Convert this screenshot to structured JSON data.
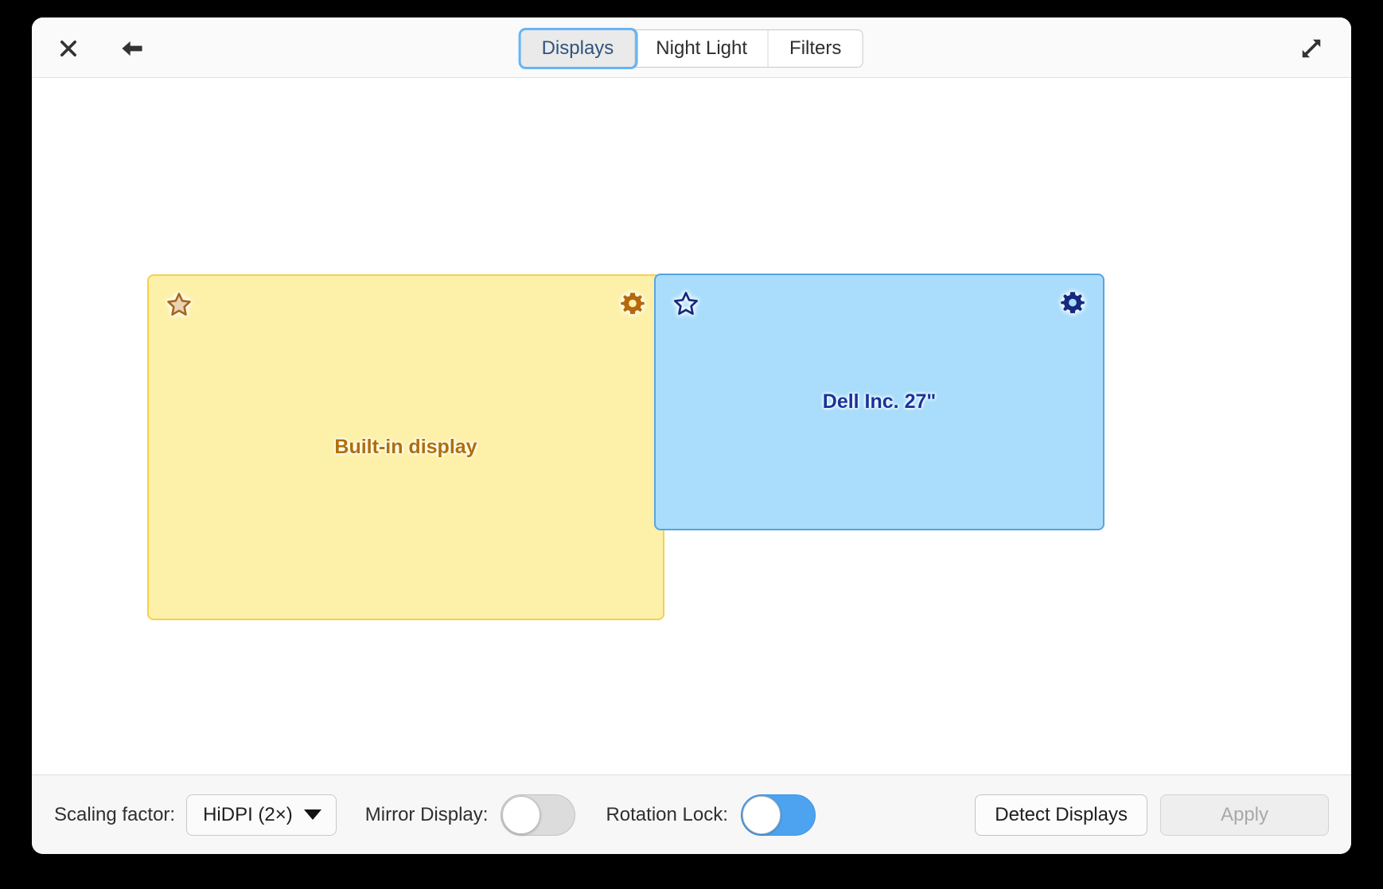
{
  "window": {
    "title": "Displays"
  },
  "header": {
    "close_icon": "close-icon",
    "back_icon": "back-arrow-icon",
    "expand_icon": "expand-diagonal-icon",
    "tabs": [
      {
        "label": "Displays",
        "active": true
      },
      {
        "label": "Night Light",
        "active": false
      },
      {
        "label": "Filters",
        "active": false
      }
    ]
  },
  "displays": [
    {
      "id": "builtin",
      "label": "Built-in display",
      "star_icon": "star-outline-icon",
      "gear_icon": "gear-icon",
      "fill_color": "#fdf0a8",
      "border_color": "#f5d04e",
      "text_color": "#b06f0a",
      "primary": true
    },
    {
      "id": "external",
      "label": "Dell Inc. 27\"",
      "star_icon": "star-outline-icon",
      "gear_icon": "gear-icon",
      "fill_color": "#a9ddfb",
      "border_color": "#57a4e0",
      "text_color": "#16349a",
      "primary": false
    }
  ],
  "footer": {
    "scaling_label": "Scaling factor:",
    "scaling_value": "HiDPI (2×)",
    "mirror_label": "Mirror Display:",
    "mirror_state": "off",
    "rotation_label": "Rotation Lock:",
    "rotation_state": "on",
    "detect_label": "Detect Displays",
    "apply_label": "Apply",
    "apply_enabled": false
  },
  "colors": {
    "accent_blue": "#4ea3f0",
    "focus_ring": "#64b5f6",
    "window_bg": "#ffffff",
    "chrome_bg": "#fafafa",
    "footer_bg": "#f7f7f7",
    "backdrop": "#000000"
  }
}
